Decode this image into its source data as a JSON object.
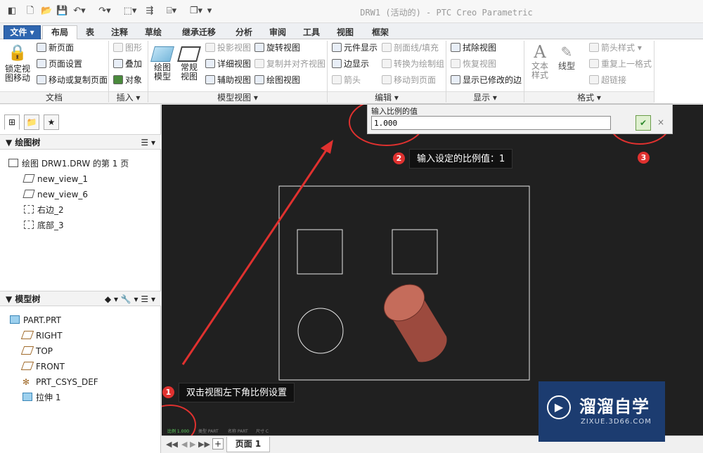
{
  "window": {
    "title": "DRW1 (活动的) - PTC Creo Parametric"
  },
  "tabs": [
    "文件",
    "布局",
    "表",
    "注释",
    "草绘",
    "继承迁移",
    "分析",
    "审阅",
    "工具",
    "视图",
    "框架"
  ],
  "active_tab": "布局",
  "ribbon": {
    "doc_group": {
      "lock_view": "锁定视图移动",
      "new_page": "新页面",
      "page_setup": "页面设置",
      "move_copy": "移动或复制页面",
      "label": "文档"
    },
    "insert_group": {
      "shape": "图形",
      "overlay": "叠加",
      "object": "对象",
      "label": "插入"
    },
    "model_view_group": {
      "drawing_model": "绘图模型",
      "general_view": "常规视图",
      "projection": "投影视图",
      "detail": "详细视图",
      "auxiliary": "辅助视图",
      "revolve": "旋转视图",
      "copy_align": "复制并对齐视图",
      "drawing_view": "绘图视图",
      "label": "模型视图"
    },
    "edit_group": {
      "component_display": "元件显示",
      "edge_display": "边显示",
      "arrow": "箭头",
      "section_fill": "剖面线/填充",
      "convert_draw": "转换为绘制组",
      "move_to_page": "移动到页面",
      "label": "编辑"
    },
    "display_group": {
      "erase_view": "拭除视图",
      "restore_view": "恢复视图",
      "show_modified_edges": "显示已修改的边",
      "label": "显示"
    },
    "format_group": {
      "text_style": "文本样式",
      "line_style": "线型",
      "arrow_style": "箭头样式",
      "repeat_last": "重复上一格式",
      "hyperlink": "超链接",
      "label": "格式"
    }
  },
  "drawing_tree": {
    "title": "绘图树",
    "items": [
      "绘图 DRW1.DRW 的第 1 页",
      "new_view_1",
      "new_view_6",
      "右边_2",
      "底部_3"
    ]
  },
  "model_tree": {
    "title": "模型树",
    "items": [
      "PART.PRT",
      "RIGHT",
      "TOP",
      "FRONT",
      "PRT_CSYS_DEF",
      "拉伸 1"
    ]
  },
  "scale_dialog": {
    "prompt": "输入比例的值",
    "value": "1.000"
  },
  "annotations": {
    "step1": {
      "num": "1",
      "text": "双击视图左下角比例设置"
    },
    "step2": {
      "num": "2",
      "text": "输入设定的比例值：1"
    },
    "step3": {
      "num": "3"
    }
  },
  "canvas_status": {
    "scale": "比例 1.000",
    "type": "类型 PART",
    "name": "名称 PART",
    "size": "尺寸 C"
  },
  "page_tabs": {
    "page_label": "页面 1"
  },
  "watermark": {
    "brand": "溜溜自学",
    "url": "ZIXUE.3D66.COM"
  },
  "colors": {
    "accent": "#2f66b0",
    "callout_red": "#e0312f",
    "cylinder": "#b85d4f",
    "canvas_bg": "#202020"
  }
}
